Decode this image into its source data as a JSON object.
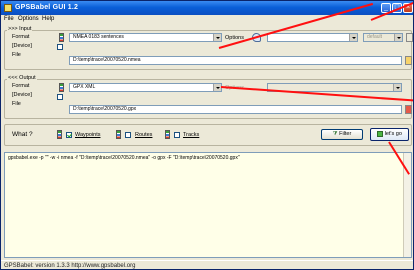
{
  "window": {
    "title": "GPSBabel GUI 1.2"
  },
  "menu": [
    "File",
    "Options",
    "Help"
  ],
  "input": {
    "legend": ">>> Input",
    "format_label": "Format",
    "device_label": "[Device]",
    "file_label": "File",
    "format_value": "NMEA 0183 sentences",
    "file_value": "D:\\temp\\trace\\20070520.nmea",
    "options_label": "Options",
    "charset_value": "",
    "extra_value": "default"
  },
  "output": {
    "legend": "<<< Output",
    "format_label": "Format",
    "device_label": "[Device]",
    "file_label": "File",
    "format_value": "GPX XML",
    "file_value": "D:\\temp\\trace\\20070520.gpx",
    "options_label": "Options"
  },
  "what": {
    "label": "What ?",
    "waypoints": "Waypoints",
    "routes": "Routes",
    "tracks": "Tracks",
    "filter": "Filter",
    "go": "let's go"
  },
  "command_text": "gpsbabel.exe -p \"\" -w -i nmea -f \"D:\\temp\\trace\\20070520.nmea\" -o gpx -F \"D:\\temp\\trace\\20070520.gpx\"",
  "status": "GPSBabel: version 1.3.3  http://www.gpsbabel.org",
  "colors": {
    "title_bar": "#0a5fd8",
    "annotation_lines": "#ff1010",
    "output_bg": "#ffffe8"
  }
}
